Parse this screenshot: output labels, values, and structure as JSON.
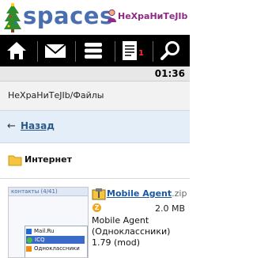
{
  "header": {
    "logo_text": "spaces",
    "username": "НеХраНиТеJIb"
  },
  "nav": {
    "items": [
      {
        "name": "home"
      },
      {
        "name": "mail"
      },
      {
        "name": "menu"
      },
      {
        "name": "journal",
        "badge": "1"
      },
      {
        "name": "search"
      }
    ]
  },
  "status": {
    "time": "01:36"
  },
  "breadcrumb": {
    "text": "НеХраНиТеJIb/Файлы"
  },
  "back": {
    "arrow": "←",
    "label": "Назад"
  },
  "folder": {
    "title": "Интернет"
  },
  "file": {
    "name": "Mobile Agent",
    "extension": ".zip",
    "size": "2.0 MB",
    "description": "Mobile Agent (Одноклассники) 1.79 (mod)",
    "thumbnail": {
      "header_text": "контакты (4/41)",
      "rows": [
        "Mail.Ru",
        "ICQ",
        "Одноклассники"
      ]
    }
  },
  "colors": {
    "logo": "#4a6fb0",
    "username": "#8e2a86",
    "nav_bg": "#000000",
    "link": "#1c57a0",
    "badge": "#ff3030"
  }
}
